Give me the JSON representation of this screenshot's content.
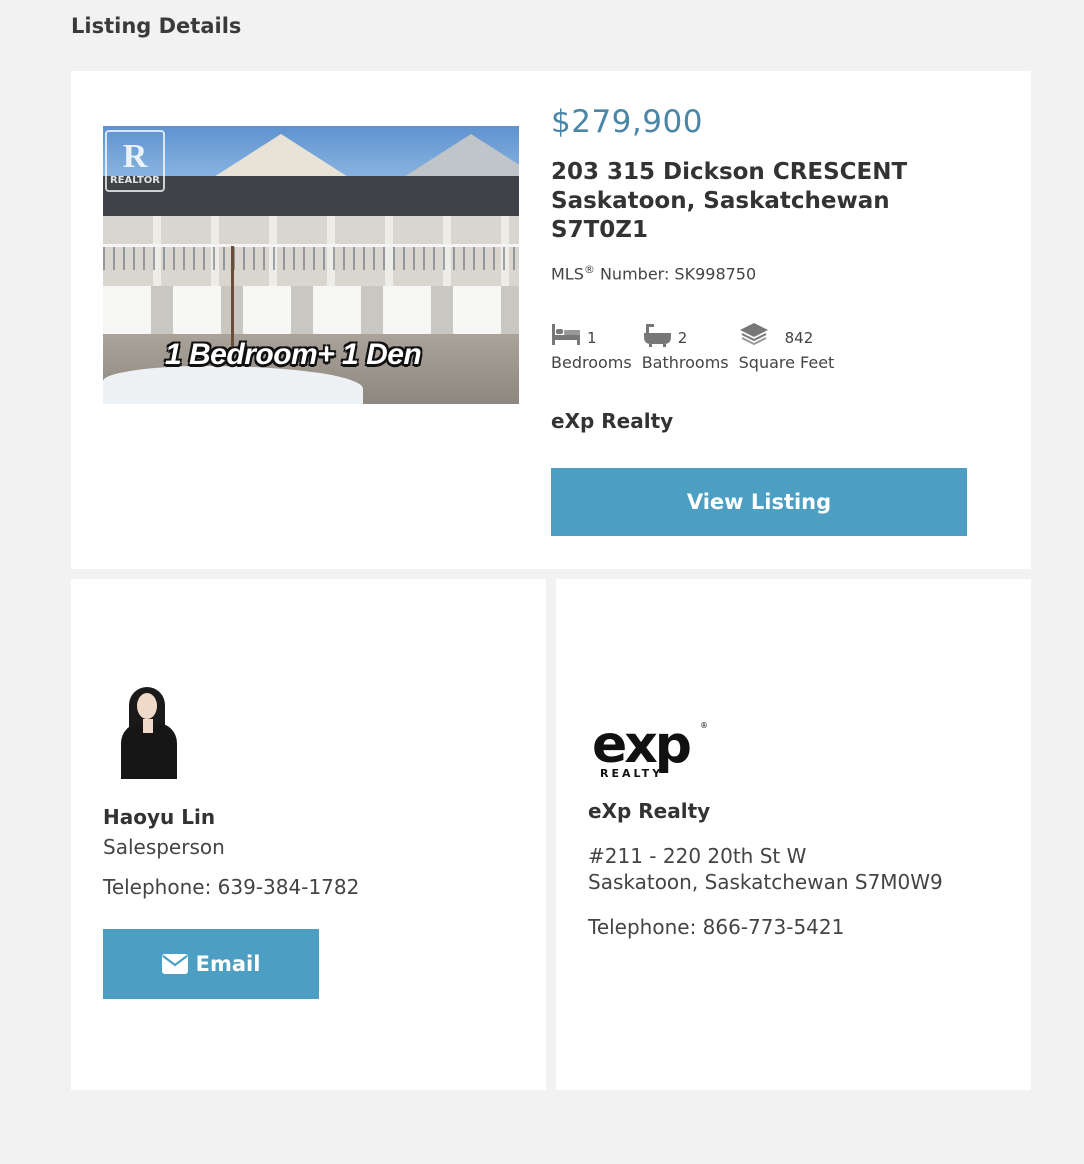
{
  "section_title": "Listing Details",
  "listing": {
    "photo_overlay_text": "1 Bedroom+ 1 Den",
    "photo_watermark": "REALTOR",
    "price": "$279,900",
    "address_line1": "203 315 Dickson CRESCENT",
    "address_line2": "Saskatoon, Saskatchewan",
    "address_line3": "S7T0Z1",
    "mls_prefix": "MLS",
    "mls_reg": "®",
    "mls_suffix": " Number: SK998750",
    "stats": [
      {
        "icon": "bed-icon",
        "value": "1",
        "label": "Bedrooms"
      },
      {
        "icon": "bathtub-icon",
        "value": "2",
        "label": "Bathrooms"
      },
      {
        "icon": "square-feet-icon",
        "value": "842",
        "label": "Square Feet"
      }
    ],
    "brokerage": "eXp Realty",
    "view_button_label": "View Listing"
  },
  "agent": {
    "name": "Haoyu Lin",
    "role": "Salesperson",
    "telephone": "Telephone: 639-384-1782",
    "email_button_label": "Email"
  },
  "office": {
    "logo_text": "exp",
    "logo_subtext": "REALTY",
    "name": "eXp Realty",
    "address_line1": "#211 - 220 20th St W",
    "address_line2": "Saskatoon, Saskatchewan S7M0W9",
    "telephone": "Telephone: 866-773-5421"
  },
  "colors": {
    "accent": "#4c9fc2",
    "price": "#4a87a6",
    "background": "#f2f2f2"
  }
}
